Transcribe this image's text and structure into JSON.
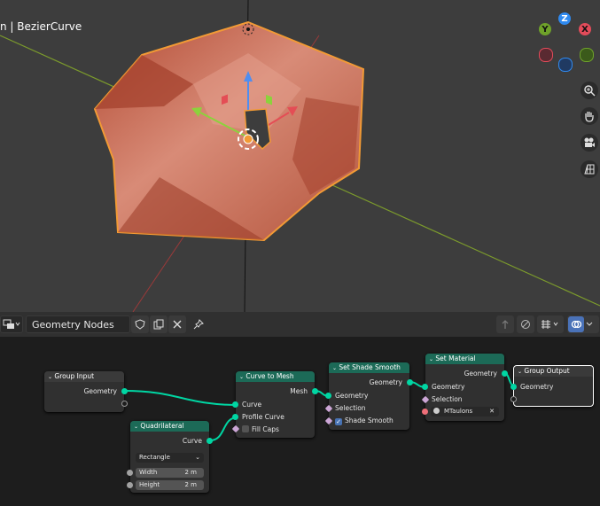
{
  "viewport": {
    "title": "n | BezierCurve",
    "axis_labels": {
      "z": "Z",
      "y": "Y",
      "x": "X"
    },
    "navigation_icons": [
      "zoom-icon",
      "hand-pan-icon",
      "camera-icon",
      "grid-icon"
    ]
  },
  "header": {
    "editor_type_icon": "node-editor-icon",
    "node_group_name": "Geometry Nodes"
  },
  "nodes": {
    "group_input": {
      "title": "Group Input",
      "outputs": [
        "Geometry"
      ]
    },
    "quadrilateral": {
      "title": "Quadrilateral",
      "output": "Curve",
      "mode": "Rectangle",
      "width_label": "Width",
      "width_value": "2 m",
      "height_label": "Height",
      "height_value": "2 m"
    },
    "curve_to_mesh": {
      "title": "Curve to Mesh",
      "output": "Mesh",
      "input_curve": "Curve",
      "input_profile": "Profile Curve",
      "fill_caps": "Fill Caps",
      "fill_caps_checked": false
    },
    "set_shade_smooth": {
      "title": "Set Shade Smooth",
      "output": "Geometry",
      "input_geometry": "Geometry",
      "input_selection": "Selection",
      "shade_smooth": "Shade Smooth",
      "shade_smooth_checked": true
    },
    "set_material": {
      "title": "Set Material",
      "output": "Geometry",
      "input_geometry": "Geometry",
      "input_selection": "Selection",
      "material": "MTaulons"
    },
    "group_output": {
      "title": "Group Output",
      "input_geometry": "Geometry"
    }
  },
  "colors": {
    "geometry_socket": "#00d6a3",
    "node_header": "#1c6a57",
    "object_orange": "#f29a35",
    "mesh_fill": "#c86a4e"
  }
}
